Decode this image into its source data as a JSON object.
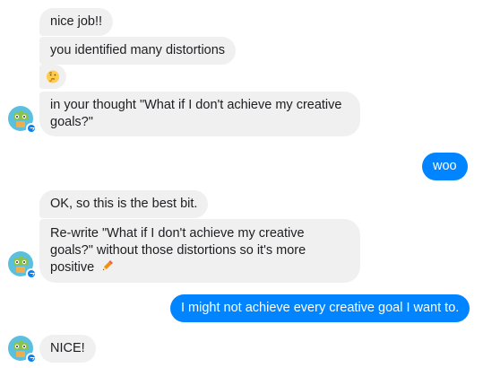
{
  "conversation": {
    "messages": [
      {
        "sender": "bot",
        "text": "nice job!!"
      },
      {
        "sender": "bot",
        "text": "you identified many distortions"
      },
      {
        "sender": "bot",
        "emoji": "thinking-face"
      },
      {
        "sender": "bot",
        "text": "in your thought \"What if I don't achieve my creative goals?\""
      },
      {
        "sender": "user",
        "text": "woo"
      },
      {
        "sender": "bot",
        "text": "OK, so this is the best bit."
      },
      {
        "sender": "bot",
        "text": "Re-write \"What if I don't achieve my creative goals?\" without those distortions so it's more positive",
        "trailing_emoji": "pencil"
      },
      {
        "sender": "user",
        "text": "I might not achieve every creative goal I want to."
      },
      {
        "sender": "bot",
        "text": "NICE!"
      }
    ]
  },
  "colors": {
    "incoming_bubble": "#f1f0f0",
    "outgoing_bubble": "#0084ff",
    "incoming_text": "#1c1e21",
    "outgoing_text": "#ffffff",
    "messenger_badge": "#0084ff"
  },
  "icons": {
    "bot_avatar": "robot-avatar-icon",
    "messenger_badge": "messenger-badge-icon",
    "thinking": "thinking-face-icon",
    "pencil": "pencil-icon"
  }
}
